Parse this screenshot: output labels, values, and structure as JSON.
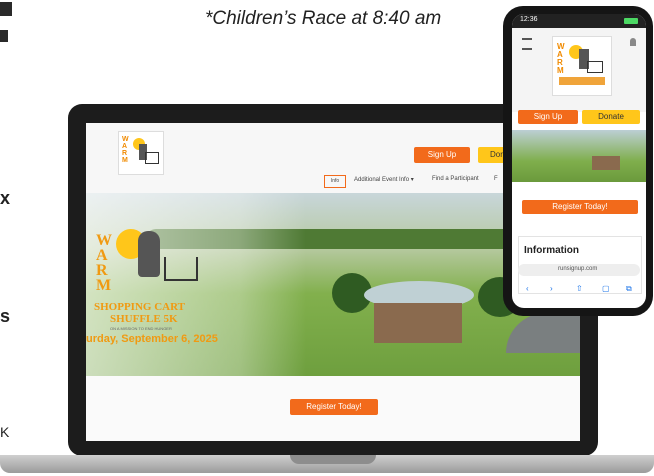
{
  "caption": "*Children’s Race at 8:40 am",
  "left_edge": {
    "frag_x": "x",
    "frag_s": "s",
    "frag_k": "K"
  },
  "laptop": {
    "nav": {
      "sign_up": "Sign Up",
      "donate": "Dor",
      "links": [
        "Info",
        "Additional Event Info ▾",
        "Find a Participant",
        "F"
      ]
    },
    "hero": {
      "logo_letters": [
        "W",
        "A",
        "R",
        "M"
      ],
      "title_line1": "SHOPPING CART",
      "title_line2": "SHUFFLE 5K",
      "tagline": "ON A MISSION TO END HUNGER",
      "date": "urday, September 6, 2025"
    },
    "register": "Register Today!"
  },
  "phone": {
    "time": "12:36",
    "sign_up": "Sign Up",
    "donate": "Donate",
    "register": "Register Today!",
    "info_heading": "Information",
    "url": "runsignup.com"
  },
  "colors": {
    "accent": "#f26a1b",
    "donate": "#ffc61a"
  }
}
